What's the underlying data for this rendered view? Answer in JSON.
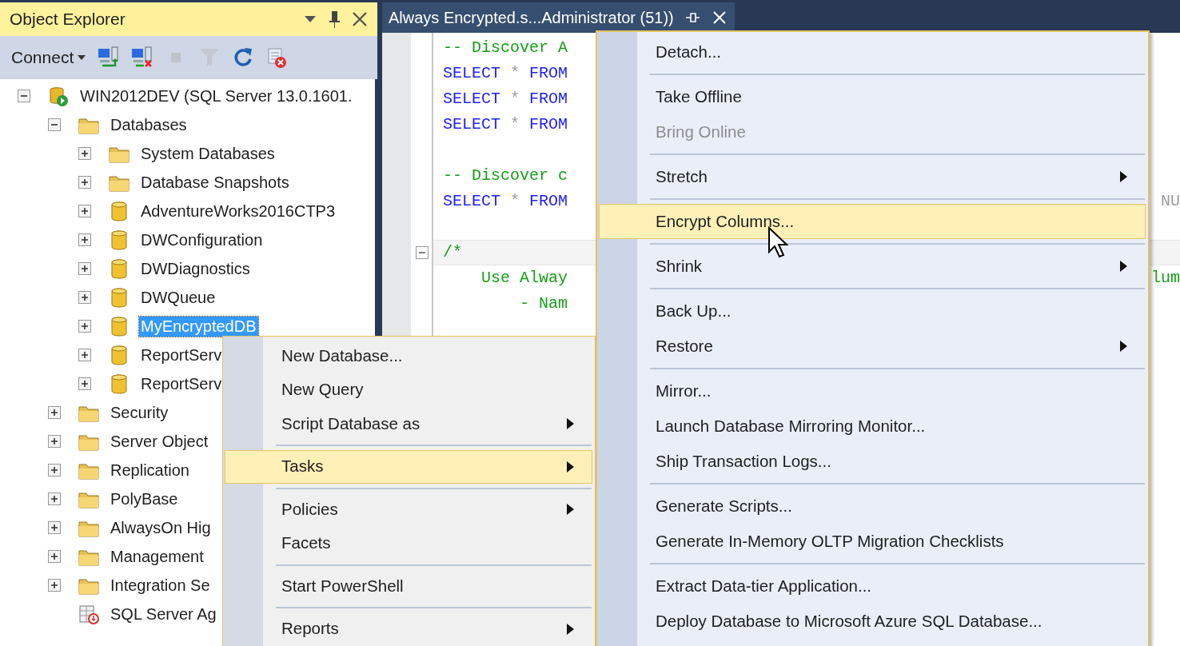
{
  "object_explorer": {
    "title": "Object Explorer",
    "toolbar": {
      "connect_label": "Connect",
      "buttons": [
        {
          "kind": "connect",
          "disabled": false
        },
        {
          "kind": "disconnect",
          "disabled": false
        },
        {
          "kind": "stop",
          "disabled": true
        },
        {
          "kind": "filter",
          "disabled": true
        },
        {
          "kind": "refresh",
          "disabled": false
        },
        {
          "kind": "stop_script",
          "disabled": false
        }
      ]
    },
    "tree": [
      {
        "label": "WIN2012DEV (SQL Server 13.0.1601.",
        "kind": "server",
        "expanded": true,
        "selected": false,
        "children": [
          {
            "label": "Databases",
            "kind": "folder",
            "expanded": true,
            "selected": false,
            "children": [
              {
                "label": "System Databases",
                "kind": "folder",
                "expanded": false,
                "selected": false
              },
              {
                "label": "Database Snapshots",
                "kind": "folder",
                "expanded": false,
                "selected": false
              },
              {
                "label": "AdventureWorks2016CTP3",
                "kind": "database",
                "expanded": false,
                "selected": false
              },
              {
                "label": "DWConfiguration",
                "kind": "database",
                "expanded": false,
                "selected": false
              },
              {
                "label": "DWDiagnostics",
                "kind": "database",
                "expanded": false,
                "selected": false
              },
              {
                "label": "DWQueue",
                "kind": "database",
                "expanded": false,
                "selected": false
              },
              {
                "label": "MyEncryptedDB",
                "kind": "database",
                "expanded": false,
                "selected": true
              },
              {
                "label": "ReportServ",
                "kind": "database",
                "expanded": false,
                "selected": false
              },
              {
                "label": "ReportServ",
                "kind": "database",
                "expanded": false,
                "selected": false
              }
            ]
          },
          {
            "label": "Security",
            "kind": "folder",
            "expanded": false,
            "selected": false
          },
          {
            "label": "Server Object",
            "kind": "folder",
            "expanded": false,
            "selected": false
          },
          {
            "label": "Replication",
            "kind": "folder",
            "expanded": false,
            "selected": false
          },
          {
            "label": "PolyBase",
            "kind": "folder",
            "expanded": false,
            "selected": false
          },
          {
            "label": "AlwaysOn Hig",
            "kind": "folder",
            "expanded": false,
            "selected": false
          },
          {
            "label": "Management",
            "kind": "folder",
            "expanded": false,
            "selected": false
          },
          {
            "label": "Integration Se",
            "kind": "folder",
            "expanded": false,
            "selected": false
          },
          {
            "label": "SQL Server Ag",
            "kind": "agent",
            "selected": false
          }
        ]
      }
    ]
  },
  "editor": {
    "tab": {
      "title": "Always Encrypted.s...Administrator (51))",
      "selected": true
    },
    "lines": [
      {
        "kind": "code",
        "segments": [
          {
            "text": "-- Discover A",
            "kind": "comment"
          }
        ]
      },
      {
        "kind": "code",
        "segments": [
          {
            "text": "SELECT",
            "kind": "keyword"
          },
          {
            "text": " * ",
            "kind": "operator"
          },
          {
            "text": "FROM",
            "kind": "keyword"
          }
        ]
      },
      {
        "kind": "code",
        "segments": [
          {
            "text": "SELECT",
            "kind": "keyword"
          },
          {
            "text": " * ",
            "kind": "operator"
          },
          {
            "text": "FROM",
            "kind": "keyword"
          }
        ]
      },
      {
        "kind": "code",
        "segments": [
          {
            "text": "SELECT",
            "kind": "keyword"
          },
          {
            "text": " * ",
            "kind": "operator"
          },
          {
            "text": "FROM",
            "kind": "keyword"
          }
        ]
      },
      {
        "kind": "blank"
      },
      {
        "kind": "code",
        "segments": [
          {
            "text": "-- Discover c",
            "kind": "comment"
          }
        ]
      },
      {
        "kind": "code",
        "segments": [
          {
            "text": "SELECT",
            "kind": "keyword"
          },
          {
            "text": " * ",
            "kind": "operator"
          },
          {
            "text": "FROM",
            "kind": "keyword"
          }
        ],
        "tail": {
          "text": "NU",
          "kind": "operator"
        }
      },
      {
        "kind": "blank"
      },
      {
        "kind": "fold",
        "segments": [
          {
            "text": "/*",
            "kind": "comment"
          }
        ]
      },
      {
        "kind": "code",
        "segments": [
          {
            "text": "    Use Alway",
            "kind": "comment"
          }
        ],
        "tail": {
          "text": "lum",
          "kind": "comment"
        }
      },
      {
        "kind": "code",
        "segments": [
          {
            "text": "        - Nam",
            "kind": "comment"
          }
        ]
      }
    ]
  },
  "context_menu": {
    "items": [
      {
        "kind": "item",
        "label": "New Database...",
        "submenu": false,
        "selected": false
      },
      {
        "kind": "item",
        "label": "New Query",
        "submenu": false,
        "selected": false
      },
      {
        "kind": "item",
        "label": "Script Database as",
        "submenu": true,
        "selected": false
      },
      {
        "kind": "separator"
      },
      {
        "kind": "item",
        "label": "Tasks",
        "submenu": true,
        "selected": true
      },
      {
        "kind": "separator"
      },
      {
        "kind": "item",
        "label": "Policies",
        "submenu": true,
        "selected": false
      },
      {
        "kind": "item",
        "label": "Facets",
        "submenu": false,
        "selected": false
      },
      {
        "kind": "separator"
      },
      {
        "kind": "item",
        "label": "Start PowerShell",
        "submenu": false,
        "selected": false
      },
      {
        "kind": "separator"
      },
      {
        "kind": "item",
        "label": "Reports",
        "submenu": true,
        "selected": false
      }
    ]
  },
  "tasks_submenu": {
    "items": [
      {
        "kind": "item",
        "label": "Detach...",
        "submenu": false,
        "selected": false,
        "disabled": false
      },
      {
        "kind": "separator"
      },
      {
        "kind": "item",
        "label": "Take Offline",
        "submenu": false,
        "selected": false,
        "disabled": false
      },
      {
        "kind": "item",
        "label": "Bring Online",
        "submenu": false,
        "selected": false,
        "disabled": true
      },
      {
        "kind": "separator"
      },
      {
        "kind": "item",
        "label": "Stretch",
        "submenu": true,
        "selected": false,
        "disabled": false
      },
      {
        "kind": "separator"
      },
      {
        "kind": "item",
        "label": "Encrypt Columns...",
        "submenu": false,
        "selected": true,
        "disabled": false
      },
      {
        "kind": "separator"
      },
      {
        "kind": "item",
        "label": "Shrink",
        "submenu": true,
        "selected": false,
        "disabled": false
      },
      {
        "kind": "separator"
      },
      {
        "kind": "item",
        "label": "Back Up...",
        "submenu": false,
        "selected": false,
        "disabled": false
      },
      {
        "kind": "item",
        "label": "Restore",
        "submenu": true,
        "selected": false,
        "disabled": false
      },
      {
        "kind": "separator"
      },
      {
        "kind": "item",
        "label": "Mirror...",
        "submenu": false,
        "selected": false,
        "disabled": false
      },
      {
        "kind": "item",
        "label": "Launch Database Mirroring Monitor...",
        "submenu": false,
        "selected": false,
        "disabled": false
      },
      {
        "kind": "item",
        "label": "Ship Transaction Logs...",
        "submenu": false,
        "selected": false,
        "disabled": false
      },
      {
        "kind": "separator"
      },
      {
        "kind": "item",
        "label": "Generate Scripts...",
        "submenu": false,
        "selected": false,
        "disabled": false
      },
      {
        "kind": "item",
        "label": "Generate In-Memory OLTP Migration Checklists",
        "submenu": false,
        "selected": false,
        "disabled": false
      },
      {
        "kind": "separator"
      },
      {
        "kind": "item",
        "label": "Extract Data-tier Application...",
        "submenu": false,
        "selected": false,
        "disabled": false
      },
      {
        "kind": "item",
        "label": "Deploy Database to Microsoft Azure SQL Database...",
        "submenu": false,
        "selected": false,
        "disabled": false
      }
    ]
  }
}
